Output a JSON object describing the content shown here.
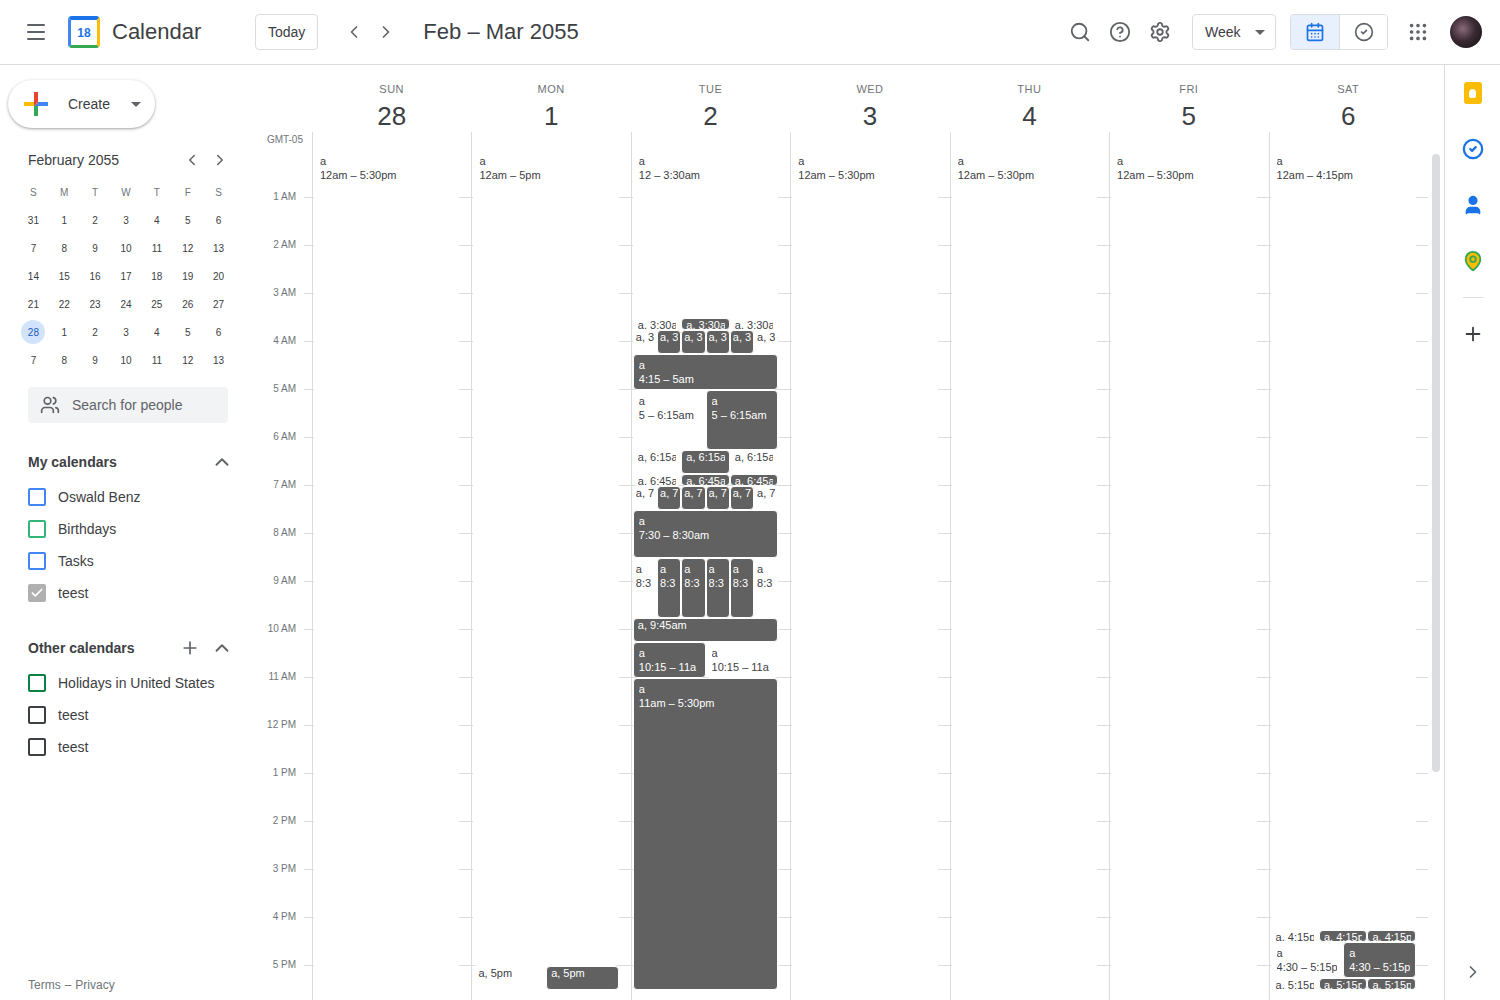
{
  "app": {
    "logo_day": "18",
    "name": "Calendar"
  },
  "toolbar": {
    "today": "Today",
    "range": "Feb – Mar 2055",
    "view": "Week",
    "view_toggle": [
      {
        "selected": true
      },
      {
        "selected": false
      }
    ]
  },
  "create": {
    "label": "Create"
  },
  "mini_calendar": {
    "title": "February 2055",
    "weekdays": [
      "S",
      "M",
      "T",
      "W",
      "T",
      "F",
      "S"
    ],
    "weeks": [
      [
        {
          "day": "31",
          "selected": false
        },
        {
          "day": "1",
          "selected": false
        },
        {
          "day": "2",
          "selected": false
        },
        {
          "day": "3",
          "selected": false
        },
        {
          "day": "4",
          "selected": false
        },
        {
          "day": "5",
          "selected": false
        },
        {
          "day": "6",
          "selected": false
        }
      ],
      [
        {
          "day": "7",
          "selected": false
        },
        {
          "day": "8",
          "selected": false
        },
        {
          "day": "9",
          "selected": false
        },
        {
          "day": "10",
          "selected": false
        },
        {
          "day": "11",
          "selected": false
        },
        {
          "day": "12",
          "selected": false
        },
        {
          "day": "13",
          "selected": false
        }
      ],
      [
        {
          "day": "14",
          "selected": false
        },
        {
          "day": "15",
          "selected": false
        },
        {
          "day": "16",
          "selected": false
        },
        {
          "day": "17",
          "selected": false
        },
        {
          "day": "18",
          "selected": false
        },
        {
          "day": "19",
          "selected": false
        },
        {
          "day": "20",
          "selected": false
        }
      ],
      [
        {
          "day": "21",
          "selected": false
        },
        {
          "day": "22",
          "selected": false
        },
        {
          "day": "23",
          "selected": false
        },
        {
          "day": "24",
          "selected": false
        },
        {
          "day": "25",
          "selected": false
        },
        {
          "day": "26",
          "selected": false
        },
        {
          "day": "27",
          "selected": false
        }
      ],
      [
        {
          "day": "28",
          "selected": true
        },
        {
          "day": "1",
          "selected": false
        },
        {
          "day": "2",
          "selected": false
        },
        {
          "day": "3",
          "selected": false
        },
        {
          "day": "4",
          "selected": false
        },
        {
          "day": "5",
          "selected": false
        },
        {
          "day": "6",
          "selected": false
        }
      ],
      [
        {
          "day": "7",
          "selected": false
        },
        {
          "day": "8",
          "selected": false
        },
        {
          "day": "9",
          "selected": false
        },
        {
          "day": "10",
          "selected": false
        },
        {
          "day": "11",
          "selected": false
        },
        {
          "day": "12",
          "selected": false
        },
        {
          "day": "13",
          "selected": false
        }
      ]
    ]
  },
  "people_search": {
    "placeholder": "Search for people"
  },
  "my_calendars": {
    "title": "My calendars",
    "expanded": true,
    "items": [
      {
        "label": "Oswald Benz",
        "checked": false,
        "color": "#4285f4"
      },
      {
        "label": "Birthdays",
        "checked": false,
        "color": "#33b679"
      },
      {
        "label": "Tasks",
        "checked": false,
        "color": "#4285f4"
      },
      {
        "label": "teest",
        "checked": true,
        "color": "#b0b0b0"
      }
    ]
  },
  "other_calendars": {
    "title": "Other calendars",
    "expanded": true,
    "items": [
      {
        "label": "Holidays in United States",
        "checked": false,
        "color": "#0b8043"
      },
      {
        "label": "teest",
        "checked": false,
        "color": "#3c4043"
      },
      {
        "label": "teest",
        "checked": false,
        "color": "#3c4043"
      }
    ]
  },
  "footer": {
    "links": [
      "Terms",
      "Privacy"
    ],
    "separator": "–"
  },
  "timezone": "GMT-05",
  "hours": [
    "1 AM",
    "2 AM",
    "3 AM",
    "4 AM",
    "5 AM",
    "6 AM",
    "7 AM",
    "8 AM",
    "9 AM",
    "10 AM",
    "11 AM",
    "12 PM",
    "1 PM",
    "2 PM",
    "3 PM",
    "4 PM",
    "5 PM"
  ],
  "days": [
    {
      "weekday": "SUN",
      "date": "28",
      "events": [
        {
          "kind": "full",
          "title": "a",
          "time": "12am – 5:30pm",
          "start": 0,
          "end": 17.5,
          "filled": false
        }
      ]
    },
    {
      "weekday": "MON",
      "date": "1",
      "events": [
        {
          "kind": "full",
          "title": "a",
          "time": "12am – 5pm",
          "start": 0,
          "end": 17,
          "filled": false
        },
        {
          "kind": "compact",
          "label": "a, 5pm",
          "start": 17,
          "end": 17.5,
          "filled": false
        },
        {
          "kind": "compact",
          "label": "a, 5pm",
          "start": 17,
          "end": 17.5,
          "filled": true
        }
      ]
    },
    {
      "weekday": "TUE",
      "date": "2",
      "events": [
        {
          "kind": "full",
          "title": "a",
          "time": "12 – 3:30am",
          "start": 0,
          "end": 3.5,
          "filled": false
        },
        {
          "kind": "compact",
          "label": "a, 3:30a",
          "start": 3.5,
          "end": 3.75,
          "filled": false
        },
        {
          "kind": "compact",
          "label": "a, 3:30a",
          "start": 3.5,
          "end": 3.75,
          "filled": true
        },
        {
          "kind": "compact",
          "label": "a, 3:30a",
          "start": 3.5,
          "end": 3.75,
          "filled": false
        },
        {
          "kind": "compact",
          "label": "a, 3",
          "start": 3.75,
          "end": 4.25,
          "filled": false
        },
        {
          "kind": "compact",
          "label": "a, 3",
          "start": 3.75,
          "end": 4.25,
          "filled": true
        },
        {
          "kind": "compact",
          "label": "a, 3",
          "start": 3.75,
          "end": 4.25,
          "filled": true
        },
        {
          "kind": "compact",
          "label": "a, 3",
          "start": 3.75,
          "end": 4.25,
          "filled": true
        },
        {
          "kind": "compact",
          "label": "a, 3",
          "start": 3.75,
          "end": 4.25,
          "filled": true
        },
        {
          "kind": "compact",
          "label": "a, 3",
          "start": 3.75,
          "end": 4.25,
          "filled": false
        },
        {
          "kind": "full",
          "title": "a",
          "time": "4:15 – 5am",
          "start": 4.25,
          "end": 5,
          "filled": true
        },
        {
          "kind": "full",
          "title": "a",
          "time": "5 – 6:15am",
          "start": 5,
          "end": 6.25,
          "filled": false
        },
        {
          "kind": "full",
          "title": "a",
          "time": "5 – 6:15am",
          "start": 5,
          "end": 6.25,
          "filled": true
        },
        {
          "kind": "compact",
          "label": "a, 6:15a",
          "start": 6.25,
          "end": 6.75,
          "filled": false
        },
        {
          "kind": "compact",
          "label": "a, 6:15a",
          "start": 6.25,
          "end": 6.75,
          "filled": true
        },
        {
          "kind": "compact",
          "label": "a, 6:15a",
          "start": 6.25,
          "end": 6.75,
          "filled": false
        },
        {
          "kind": "compact",
          "label": "a, 6:45a",
          "start": 6.75,
          "end": 7,
          "filled": false
        },
        {
          "kind": "compact",
          "label": "a, 6:45a",
          "start": 6.75,
          "end": 7,
          "filled": true
        },
        {
          "kind": "compact",
          "label": "a, 6:45a",
          "start": 6.75,
          "end": 7,
          "filled": true
        },
        {
          "kind": "compact",
          "label": "a, 7",
          "start": 7,
          "end": 7.5,
          "filled": false
        },
        {
          "kind": "compact",
          "label": "a, 7",
          "start": 7,
          "end": 7.5,
          "filled": true
        },
        {
          "kind": "compact",
          "label": "a, 7",
          "start": 7,
          "end": 7.5,
          "filled": true
        },
        {
          "kind": "compact",
          "label": "a, 7",
          "start": 7,
          "end": 7.5,
          "filled": true
        },
        {
          "kind": "compact",
          "label": "a, 7",
          "start": 7,
          "end": 7.5,
          "filled": true
        },
        {
          "kind": "compact",
          "label": "a, 7",
          "start": 7,
          "end": 7.5,
          "filled": false
        },
        {
          "kind": "full",
          "title": "a",
          "time": "7:30 – 8:30am",
          "start": 7.5,
          "end": 8.5,
          "filled": true
        },
        {
          "kind": "full",
          "title": "a",
          "time": "8:3",
          "start": 8.5,
          "end": 9.75,
          "filled": false
        },
        {
          "kind": "full",
          "title": "a",
          "time": "8:3",
          "start": 8.5,
          "end": 9.75,
          "filled": true
        },
        {
          "kind": "full",
          "title": "a",
          "time": "8:3",
          "start": 8.5,
          "end": 9.75,
          "filled": true
        },
        {
          "kind": "full",
          "title": "a",
          "time": "8:3",
          "start": 8.5,
          "end": 9.75,
          "filled": true
        },
        {
          "kind": "full",
          "title": "a",
          "time": "8:3",
          "start": 8.5,
          "end": 9.75,
          "filled": true
        },
        {
          "kind": "full",
          "title": "a",
          "time": "8:3",
          "start": 8.5,
          "end": 9.75,
          "filled": false
        },
        {
          "kind": "compact",
          "label": "a, 9:45am",
          "start": 9.75,
          "end": 10.25,
          "filled": true
        },
        {
          "kind": "full",
          "title": "a",
          "time": "10:15 – 11a",
          "start": 10.25,
          "end": 11,
          "filled": true
        },
        {
          "kind": "full",
          "title": "a",
          "time": "10:15 – 11a",
          "start": 10.25,
          "end": 11,
          "filled": false
        },
        {
          "kind": "full",
          "title": "a",
          "time": "11am – 5:30pm",
          "start": 11,
          "end": 17.5,
          "filled": true
        }
      ]
    },
    {
      "weekday": "WED",
      "date": "3",
      "events": [
        {
          "kind": "full",
          "title": "a",
          "time": "12am – 5:30pm",
          "start": 0,
          "end": 17.5,
          "filled": false
        }
      ]
    },
    {
      "weekday": "THU",
      "date": "4",
      "events": [
        {
          "kind": "full",
          "title": "a",
          "time": "12am – 5:30pm",
          "start": 0,
          "end": 17.5,
          "filled": false
        }
      ]
    },
    {
      "weekday": "FRI",
      "date": "5",
      "events": [
        {
          "kind": "full",
          "title": "a",
          "time": "12am – 5:30pm",
          "start": 0,
          "end": 17.5,
          "filled": false
        }
      ]
    },
    {
      "weekday": "SAT",
      "date": "6",
      "events": [
        {
          "kind": "full",
          "title": "a",
          "time": "12am – 4:15pm",
          "start": 0,
          "end": 16.25,
          "filled": false
        },
        {
          "kind": "compact",
          "label": "a, 4:15p",
          "start": 16.25,
          "end": 16.5,
          "filled": false
        },
        {
          "kind": "compact",
          "label": "a, 4:15p",
          "start": 16.25,
          "end": 16.5,
          "filled": true
        },
        {
          "kind": "compact",
          "label": "a, 4:15p",
          "start": 16.25,
          "end": 16.5,
          "filled": true
        },
        {
          "kind": "full",
          "title": "a",
          "time": "4:30 – 5:15p",
          "start": 16.5,
          "end": 17.25,
          "filled": false
        },
        {
          "kind": "full",
          "title": "a",
          "time": "4:30 – 5:15p",
          "start": 16.5,
          "end": 17.25,
          "filled": true
        },
        {
          "kind": "compact",
          "label": "a, 5:15p",
          "start": 17.25,
          "end": 17.5,
          "filled": false
        },
        {
          "kind": "compact",
          "label": "a, 5:15p",
          "start": 17.25,
          "end": 17.5,
          "filled": true
        },
        {
          "kind": "compact",
          "label": "a, 5:15p",
          "start": 17.25,
          "end": 17.5,
          "filled": true
        }
      ]
    }
  ]
}
